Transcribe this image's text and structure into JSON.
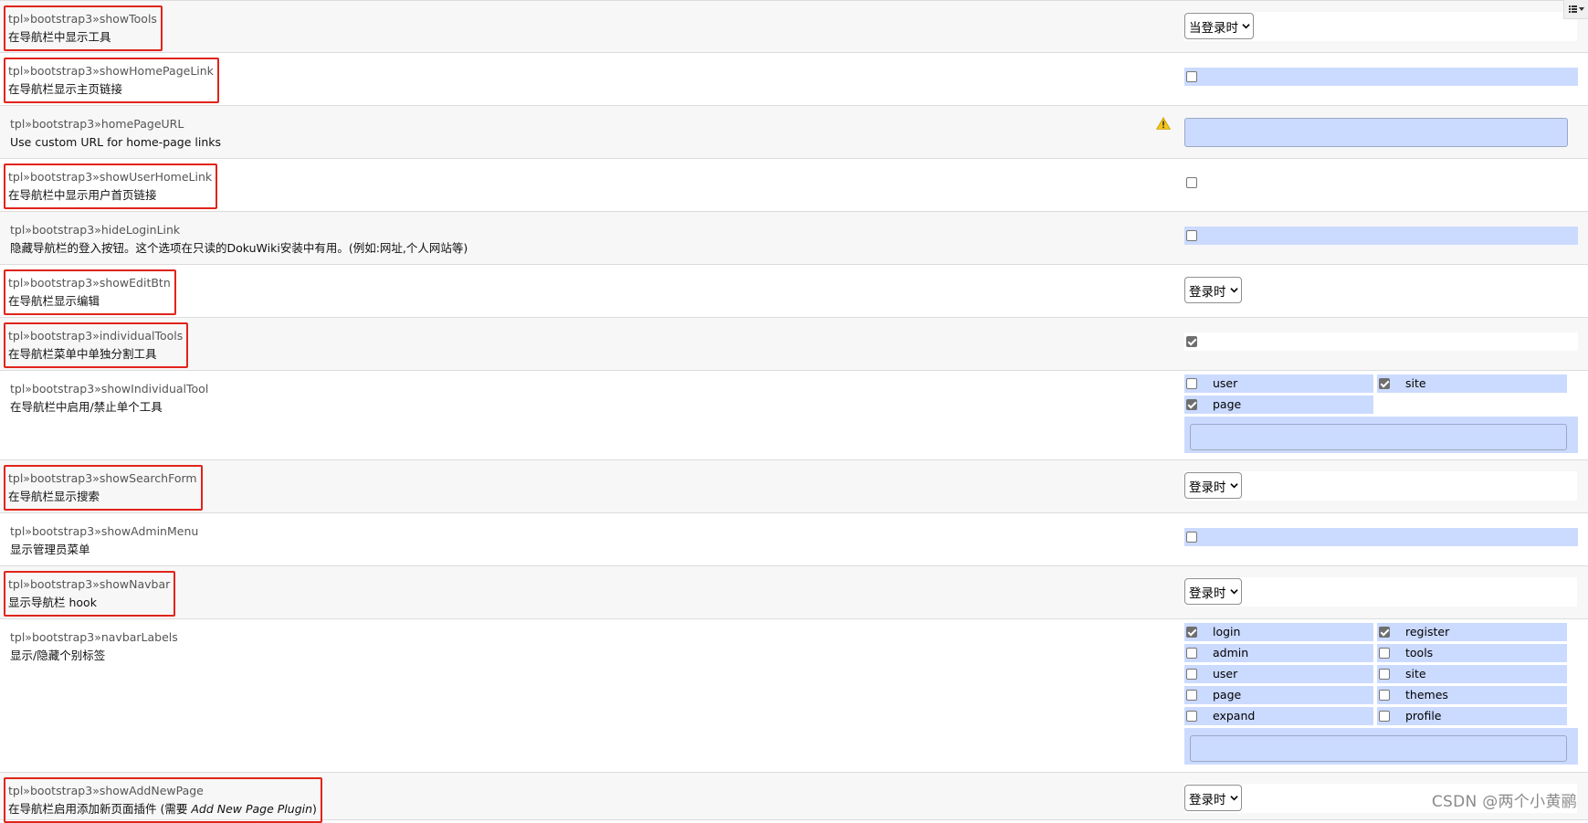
{
  "rows": [
    {
      "key": "tpl»bootstrap3»showTools",
      "desc": "在导航栏中显示工具",
      "control": "select",
      "value": "当登录时",
      "highlight": true
    },
    {
      "key": "tpl»bootstrap3»showHomePageLink",
      "desc": "在导航栏显示主页链接",
      "control": "checkbox",
      "checked": false,
      "highlight": true
    },
    {
      "key": "tpl»bootstrap3»homePageURL",
      "desc": "Use custom URL for home-page links",
      "control": "text",
      "value": "",
      "warning": true,
      "highlight": false
    },
    {
      "key": "tpl»bootstrap3»showUserHomeLink",
      "desc": "在导航栏中显示用户首页链接",
      "control": "checkbox",
      "checked": false,
      "highlight": true
    },
    {
      "key": "tpl»bootstrap3»hideLoginLink",
      "desc": "隐藏导航栏的登入按钮。这个选项在只读的DokuWiki安装中有用。(例如:网址,个人网站等)",
      "control": "checkbox",
      "checked": false,
      "highlight": false
    },
    {
      "key": "tpl»bootstrap3»showEditBtn",
      "desc": "在导航栏显示编辑",
      "control": "select",
      "value": "登录时",
      "highlight": true
    },
    {
      "key": "tpl»bootstrap3»individualTools",
      "desc": "在导航栏菜单中单独分割工具",
      "control": "checkbox",
      "checked": true,
      "highlight": true
    },
    {
      "key": "tpl»bootstrap3»showIndividualTool",
      "desc": "在导航栏中启用/禁止单个工具",
      "control": "multi",
      "options": [
        {
          "label": "user",
          "checked": false
        },
        {
          "label": "site",
          "checked": true
        },
        {
          "label": "page",
          "checked": true
        }
      ],
      "highlight": false
    },
    {
      "key": "tpl»bootstrap3»showSearchForm",
      "desc": "在导航栏显示搜索",
      "control": "select",
      "value": "登录时",
      "highlight": true
    },
    {
      "key": "tpl»bootstrap3»showAdminMenu",
      "desc": "显示管理员菜单",
      "control": "checkbox",
      "checked": false,
      "highlight": false
    },
    {
      "key": "tpl»bootstrap3»showNavbar",
      "desc": "显示导航栏 hook",
      "control": "select",
      "value": "登录时",
      "highlight": true
    },
    {
      "key": "tpl»bootstrap3»navbarLabels",
      "desc": "显示/隐藏个别标签",
      "control": "multi",
      "options": [
        {
          "label": "login",
          "checked": true
        },
        {
          "label": "register",
          "checked": true
        },
        {
          "label": "admin",
          "checked": false
        },
        {
          "label": "tools",
          "checked": false
        },
        {
          "label": "user",
          "checked": false
        },
        {
          "label": "site",
          "checked": false
        },
        {
          "label": "page",
          "checked": false
        },
        {
          "label": "themes",
          "checked": false
        },
        {
          "label": "expand",
          "checked": false
        },
        {
          "label": "profile",
          "checked": false
        }
      ],
      "highlight": false
    },
    {
      "key": "tpl»bootstrap3»showAddNewPage",
      "desc": "在导航栏启用添加新页面插件 (需要 ",
      "desc_em": "Add New Page Plugin",
      "desc_end": ")",
      "control": "select",
      "value": "登录时",
      "highlight": true
    }
  ],
  "watermark": "CSDN @两个小黄鹂",
  "icons": {
    "warning": "warning-icon",
    "corner": "list-menu-icon",
    "select": "chevron-down-icon"
  },
  "colors": {
    "highlight": "#e0241b",
    "input_bg": "#cbdaff"
  }
}
